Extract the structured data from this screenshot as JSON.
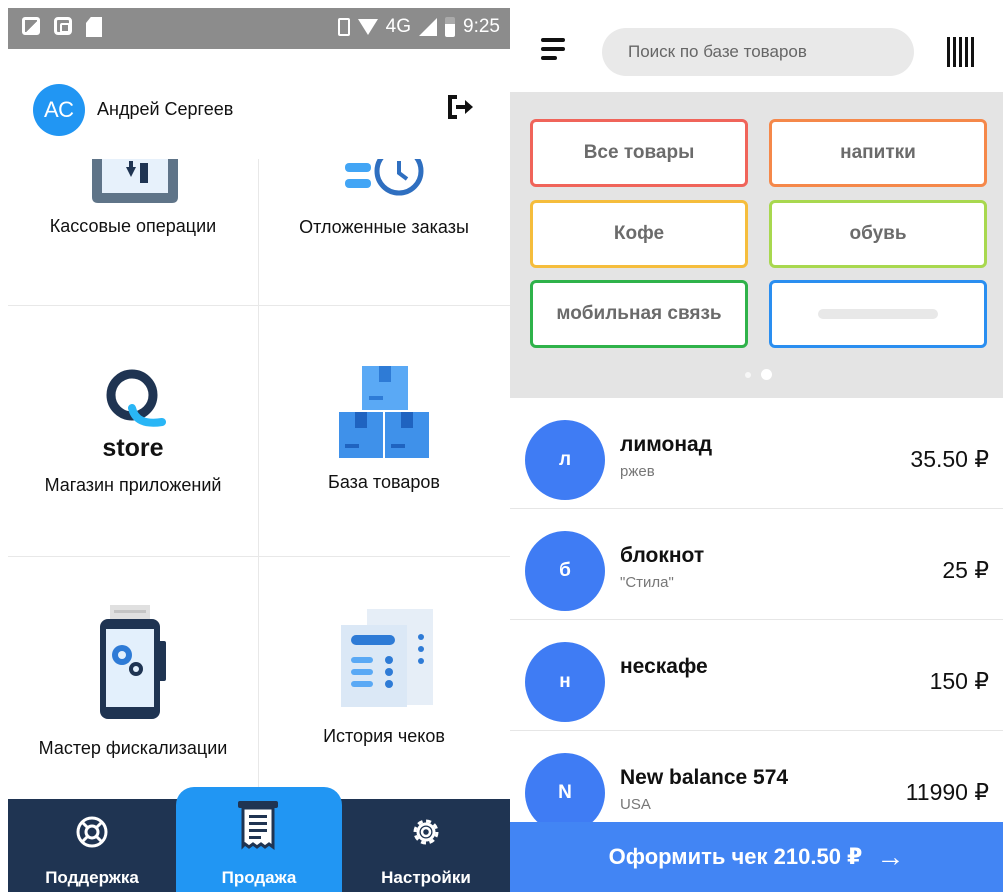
{
  "status_bar": {
    "network": "4G",
    "time": "9:25"
  },
  "profile": {
    "initials": "АС",
    "name": "Андрей Сергеев"
  },
  "menu": {
    "cash_ops": "Кассовые операции",
    "deferred_orders": "Отложенные заказы",
    "app_store_logo": "store",
    "app_store": "Магазин приложений",
    "product_base": "База товаров",
    "fiscal_wizard": "Мастер фискализации",
    "receipt_history": "История чеков"
  },
  "bottom_nav": {
    "support": "Поддержка",
    "sale": "Продажа",
    "settings": "Настройки"
  },
  "search": {
    "placeholder": "Поиск по базе товаров"
  },
  "categories": [
    {
      "label": "Все товары",
      "color": "#f0645a"
    },
    {
      "label": "напитки",
      "color": "#f5884a"
    },
    {
      "label": "Кофе",
      "color": "#f5bd3c"
    },
    {
      "label": "обувь",
      "color": "#a8d84f"
    },
    {
      "label": "мобильная связь",
      "color": "#2fb24a"
    },
    {
      "label": "",
      "color": "#2a8ef0"
    }
  ],
  "products": [
    {
      "initial": "л",
      "name": "лимонад",
      "sub": "ржев",
      "price": "35.50 ₽"
    },
    {
      "initial": "б",
      "name": "блокнот",
      "sub": "\"Стила\"",
      "price": "25 ₽"
    },
    {
      "initial": "н",
      "name": "нескафе",
      "sub": "",
      "price": "150 ₽"
    },
    {
      "initial": "N",
      "name": "New balance 574",
      "sub": "USA",
      "price": "11990 ₽"
    }
  ],
  "checkout": {
    "label": "Оформить чек 210.50 ₽",
    "arrow": "→"
  },
  "colors": {
    "accent": "#2196f3",
    "nav_bg": "#1f3452",
    "checkout_bg": "#4285f4",
    "product_avatar": "#3f7cf4"
  }
}
